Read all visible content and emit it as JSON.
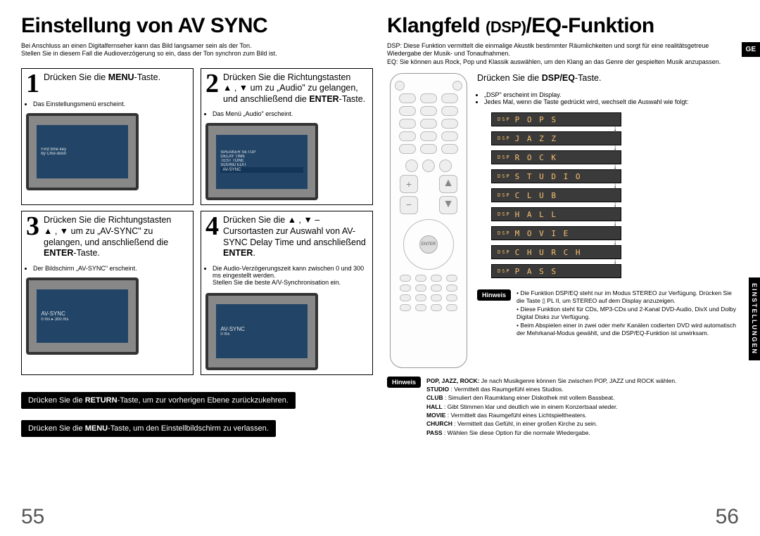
{
  "left": {
    "title": "Einstellung von AV SYNC",
    "intro": "Bei Anschluss an einen Digitalfernseher kann das Bild langsamer sein als der Ton.\nStellen Sie in diesem Fall die Audioverzögerung so ein, dass der Ton synchron zum Bild ist.",
    "steps": {
      "s1": {
        "num": "1",
        "text_a": "Drücken Sie die",
        "text_b": "MENU",
        "text_c": "-Taste.",
        "bullet": "Das Einstellungsmenü erscheint."
      },
      "s2": {
        "num": "2",
        "text_a": "Drücken Sie die Richtungstasten",
        "text_b": "▲ , ▼ um zu „Audio\" zu gelangen, und anschließend die ",
        "text_c": "ENTER",
        "text_d": "-Taste.",
        "bullet": "Das Menü „Audio\" erscheint."
      },
      "s3": {
        "num": "3",
        "text_a": "Drücken Sie die Richtungstasten",
        "text_b": "▲ , ▼ um zu „AV-SYNC\" zu gelangen, und anschließend die ",
        "text_c": "ENTER",
        "text_d": "-Taste.",
        "bullet": "Der Bildschirm „AV-SYNC\" erscheint."
      },
      "s4": {
        "num": "4",
        "text_a": "Drücken Sie die ▲ , ▼ –Cursortasten zur Auswahl von AV-SYNC Delay Time und anschließend ",
        "text_b": "ENTER",
        "text_c": ".",
        "bullet1": "Die Audio-Verzögerungszeit kann zwischen 0 und 300 ms eingestellt werden.",
        "bullet2": "Stellen Sie die beste A/V-Synchronisation ein."
      }
    },
    "bar1_a": "Drücken Sie die ",
    "bar1_b": "RETURN",
    "bar1_c": "-Taste, um zur vorherigen Ebene zurückzukehren.",
    "bar2_a": "Drücken Sie die ",
    "bar2_b": "MENU",
    "bar2_c": "-Taste, um den Einstellbildschirm zu verlassen.",
    "pagenum": "55"
  },
  "right": {
    "title_a": "Klangfeld ",
    "title_b": "(DSP)",
    "title_c": "/EQ-Funktion",
    "intro": "DSP: Diese Funktion vermittelt die einmalige Akustik bestimmter Räumlichkeiten und sorgt für eine realitätsgetreue Wiedergabe der Musik- und Tonaufnahmen.\nEQ: Sie können aus Rock, Pop und Klassik auswählen, um den Klang an das Genre der gespielten Musik anzupassen.",
    "instr_a": "Drücken Sie die ",
    "instr_b": "DSP/EQ",
    "instr_c": "-Taste.",
    "bul1": "„DSP\" erscheint im Display.",
    "bul2": "Jedes Mal, wenn die Taste gedrückt wird, wechselt die Auswahl wie folgt:",
    "modes": [
      "POPS",
      "JAZZ",
      "ROCK",
      "STUDIO",
      "CLUB",
      "HALL",
      "MOVIE",
      "CHURCH",
      "PASS"
    ],
    "hinweis_label": "Hinweis",
    "hinweis1": "Die Funktion DSP/EQ steht nur im Modus STEREO zur Verfügung. Drücken Sie die Taste ▯ PL II, um STEREO auf dem Display anzuzeigen.",
    "hinweis2": "Diese Funktion steht für CDs, MP3-CDs und 2-Kanal DVD-Audio, DivX und Dolby Digital Disks zur Verfügung.",
    "hinweis3": "Beim Abspielen einer in zwei oder mehr Kanälen codierten DVD wird automatisch der Mehrkanal-Modus gewählt, und die DSP/EQ-Funktion ist unwirksam.",
    "legend_items": [
      {
        "k": "POP, JAZZ, ROCK:",
        "v": " Je nach Musikgenre können Sie zwischen POP, JAZZ und ROCK wählen."
      },
      {
        "k": "STUDIO",
        "v": " : Vermittelt das Raumgefühl eines Studios."
      },
      {
        "k": "CLUB",
        "v": " : Simuliert den Raumklang einer Diskothek mit vollem Bassbeat."
      },
      {
        "k": "HALL",
        "v": " : Gibt Stimmen klar und deutlich wie in einem Konzertsaal wieder."
      },
      {
        "k": "MOVIE",
        "v": " : Vermittelt das Raumgefühl eines Lichtspieltheaters."
      },
      {
        "k": "CHURCH",
        "v": " : Vermittelt das Gefühl, in einer großen Kirche zu sein."
      },
      {
        "k": "PASS",
        "v": " : Wählen Sie diese Option für die normale Wiedergabe."
      }
    ],
    "ge": "GE",
    "sidetab": "EINSTELLUNGEN",
    "pagenum": "56"
  }
}
